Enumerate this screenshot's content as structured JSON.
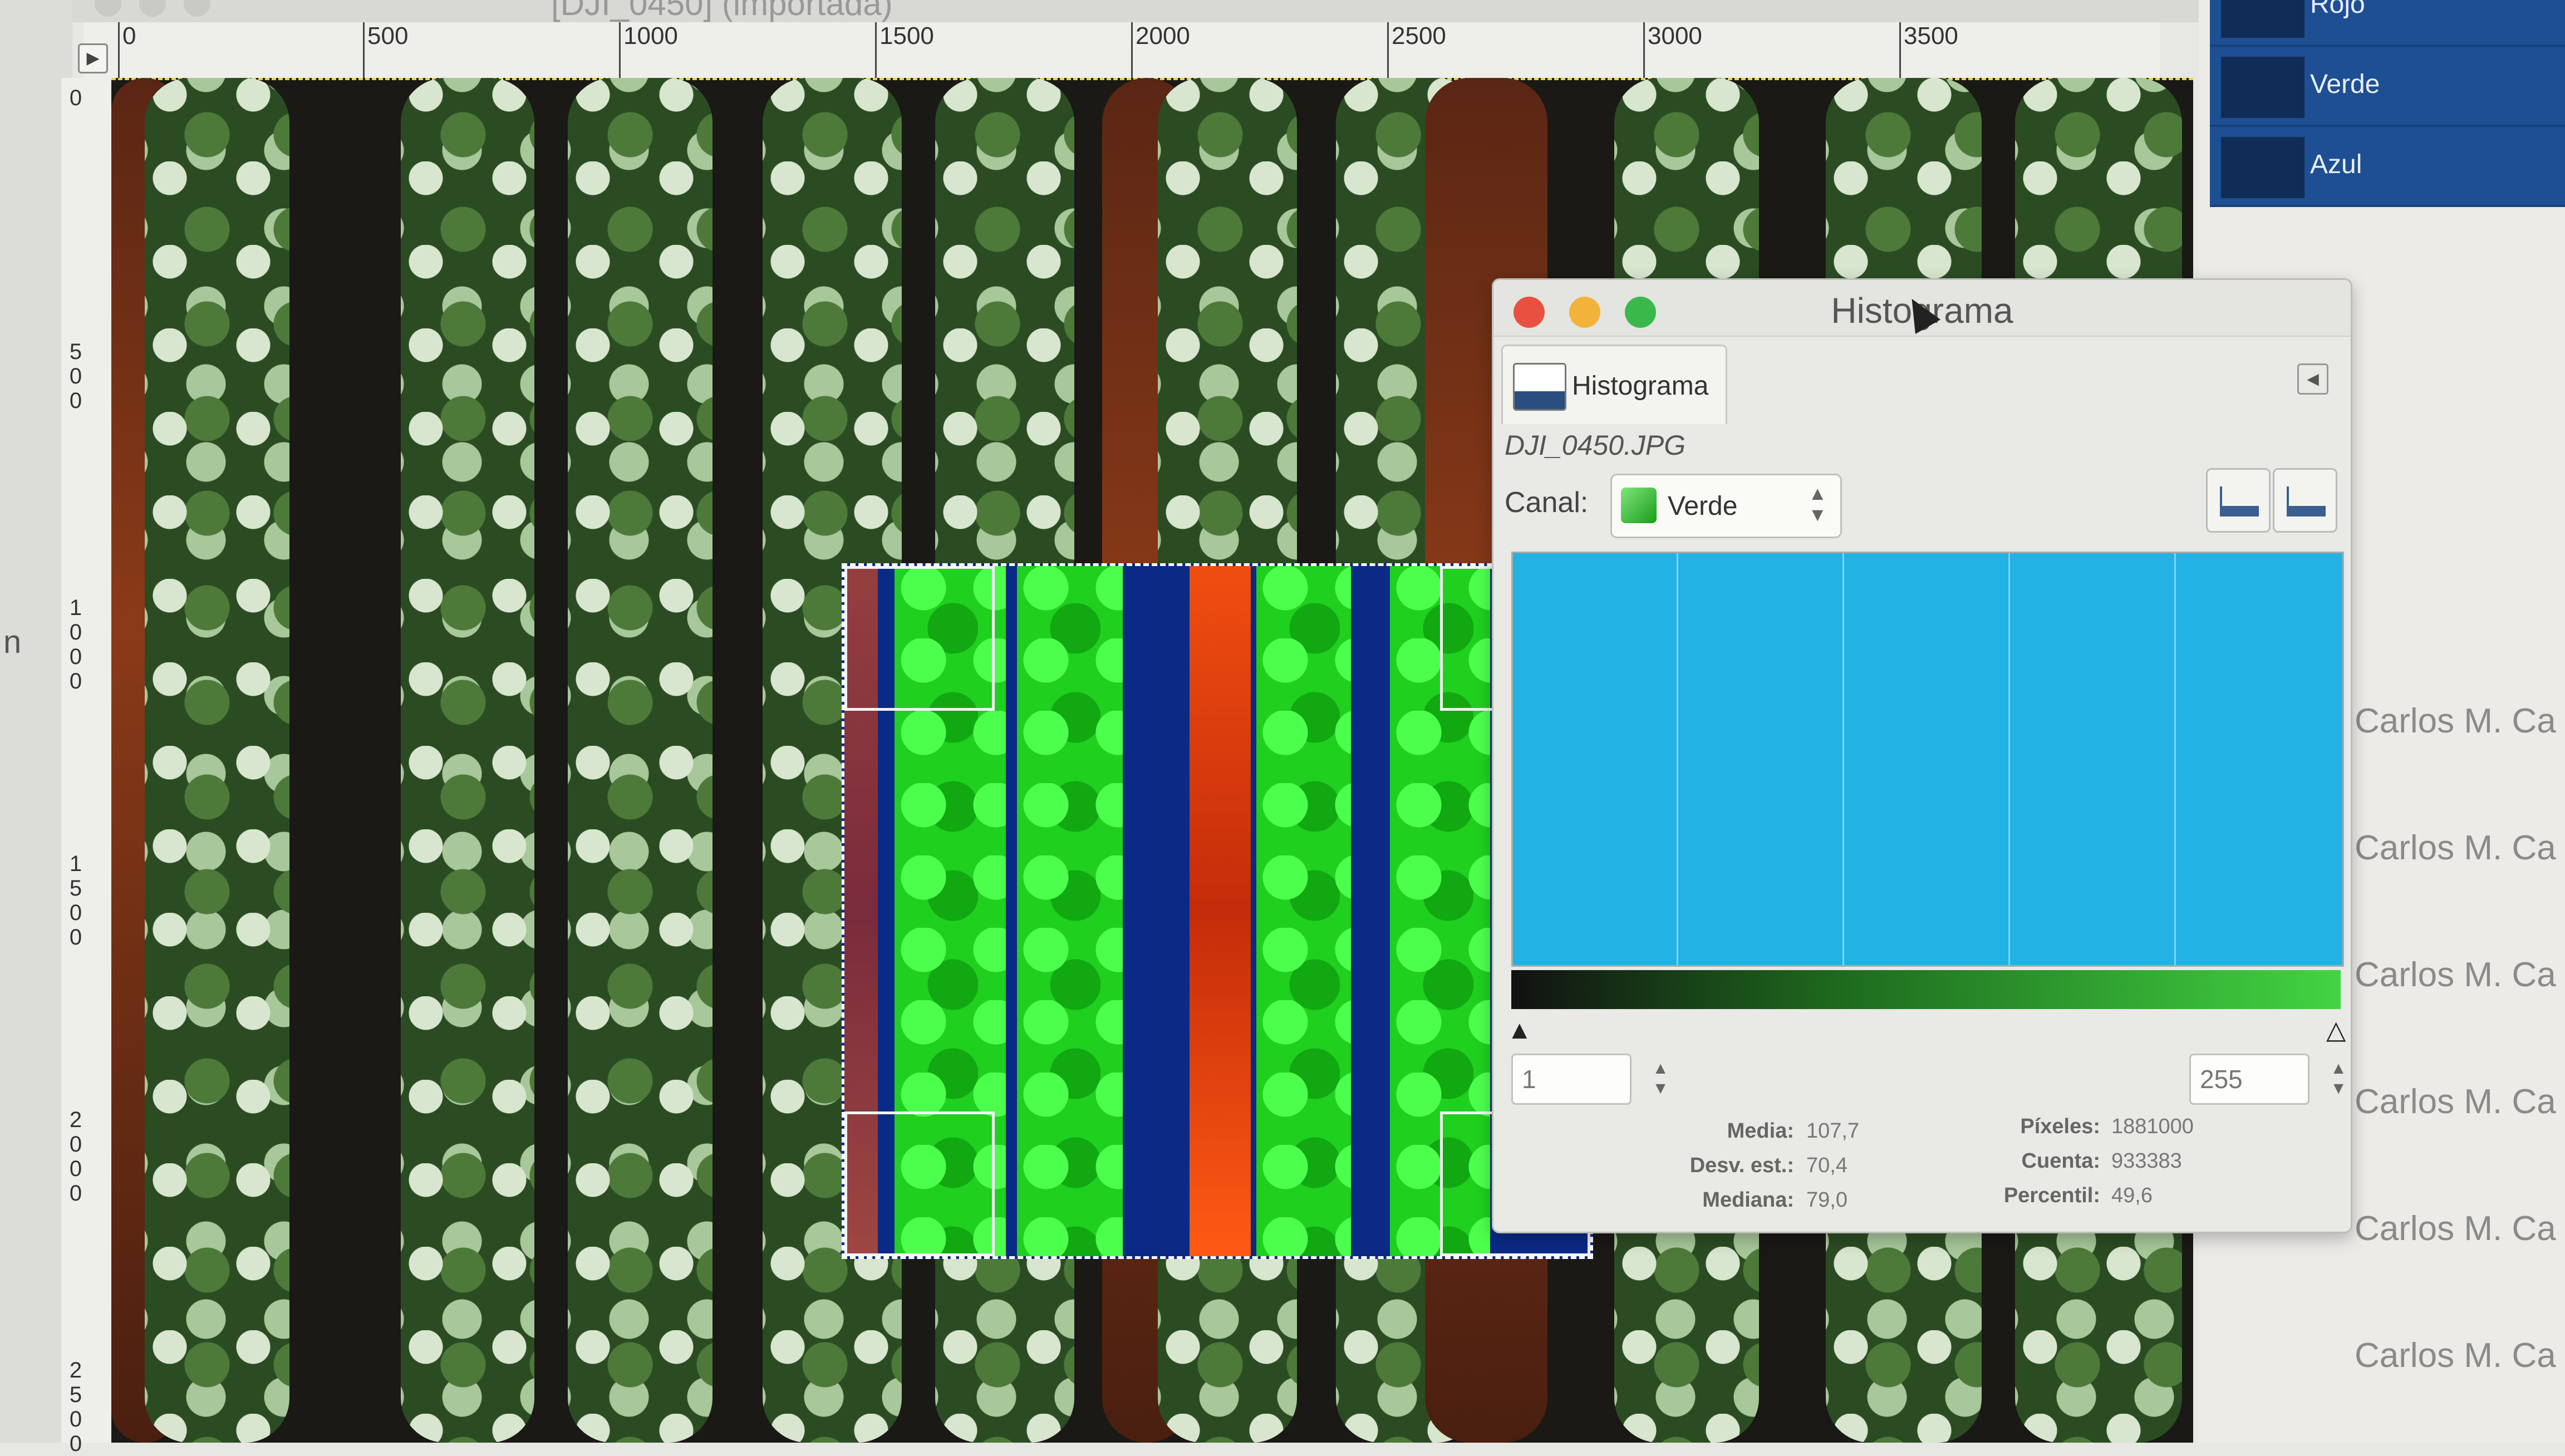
{
  "window": {
    "title": "[DJI_0450] (importada)"
  },
  "ruler": {
    "h_ticks": [
      "0",
      "500",
      "1000",
      "1500",
      "2000",
      "2500",
      "3000",
      "3500"
    ],
    "v_ticks": [
      "0",
      "500",
      "1000",
      "1500",
      "2000",
      "2500"
    ]
  },
  "side_cutoff_text": "n",
  "channels_panel": {
    "items": [
      {
        "label": "Rojo"
      },
      {
        "label": "Verde"
      },
      {
        "label": "Azul"
      }
    ]
  },
  "background_list": {
    "authors": [
      "Carlos M. Ca",
      "Carlos M. Ca",
      "Carlos M. Ca",
      "Carlos M. Ca",
      "Carlos M. Ca",
      "Carlos M. Ca"
    ]
  },
  "histogram_dialog": {
    "title": "Histograma",
    "tab_label": "Histograma",
    "filename": "DJI_0450.JPG",
    "channel_label": "Canal:",
    "channel_value": "Verde",
    "range_min": "1",
    "range_max": "255",
    "stats": {
      "media_label": "Media:",
      "media_value": "107,7",
      "desv_label": "Desv. est.:",
      "desv_value": "70,4",
      "mediana_label": "Mediana:",
      "mediana_value": "79,0",
      "pixeles_label": "Píxeles:",
      "pixeles_value": "1881000",
      "cuenta_label": "Cuenta:",
      "cuenta_value": "933383",
      "percentil_label": "Percentil:",
      "percentil_value": "49,6"
    },
    "colors": {
      "plot_fill": "#22b2e4",
      "close": "#e8503f",
      "minimize": "#f3b33a",
      "zoom": "#3bb84a"
    }
  }
}
